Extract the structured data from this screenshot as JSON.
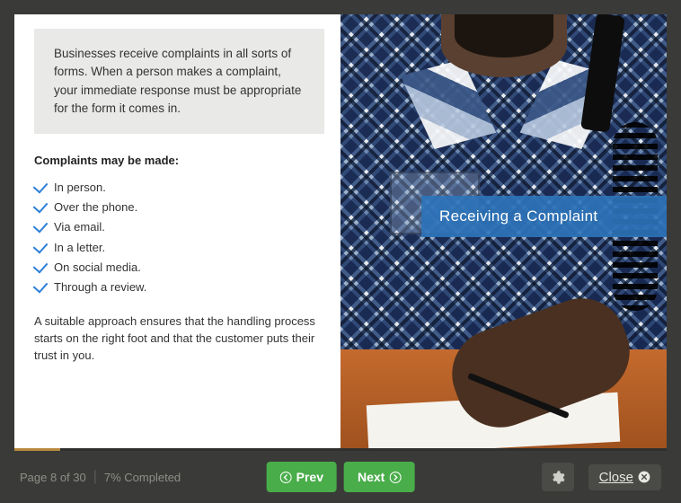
{
  "intro": "Businesses receive complaints in all sorts of forms. When a person makes a complaint, your immediate response must be appropriate for the form it comes in.",
  "subhead": "Complaints may be made:",
  "bullets": [
    "In person.",
    "Over the phone.",
    "Via email.",
    "In a letter.",
    "On social media.",
    "Through a review."
  ],
  "followup": "A suitable approach ensures that the handling process starts on the right foot and that the customer puts their trust in you.",
  "overlay_title": "Receiving a Complaint",
  "footer": {
    "page_label": "Page 8 of 30",
    "completion": "7% Completed",
    "prev": "Prev",
    "next": "Next",
    "close": "Close"
  },
  "progress_percent": 7,
  "current_page": 8,
  "total_pages": 30
}
